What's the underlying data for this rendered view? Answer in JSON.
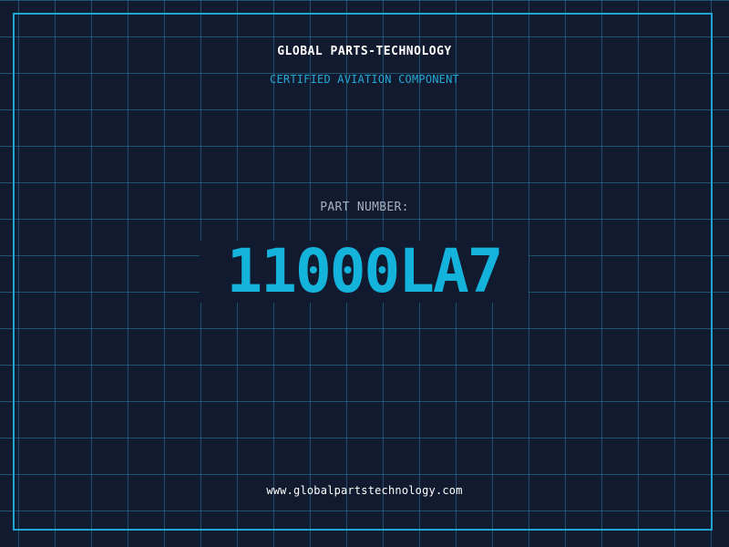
{
  "header": {
    "company": "GLOBAL PARTS-TECHNOLOGY",
    "subtitle": "CERTIFIED AVIATION COMPONENT"
  },
  "part": {
    "label": "PART NUMBER:",
    "number": "11000LA7"
  },
  "footer": {
    "website": "www.globalpartstechnology.com"
  },
  "colors": {
    "background": "#111a2e",
    "grid": "#2c7ea0",
    "frame": "#1ea5d0",
    "accent": "#14b3dc",
    "label": "#a6b1c1",
    "text": "#ffffff"
  }
}
